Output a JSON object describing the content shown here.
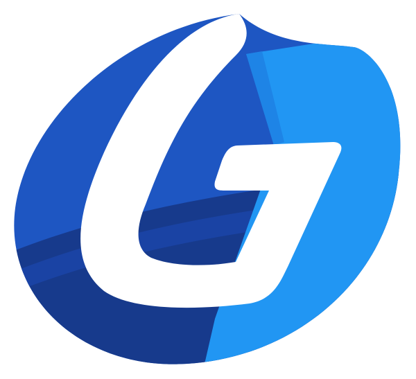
{
  "logo": {
    "name": "G logo",
    "colors": {
      "dark_blue": "#1E56C2",
      "navy": "#173A8C",
      "mid_navy": "#1D47AE",
      "light_blue": "#2196F3",
      "sky_stripe": "#1E84E6",
      "letter": "#FFFFFF"
    }
  }
}
